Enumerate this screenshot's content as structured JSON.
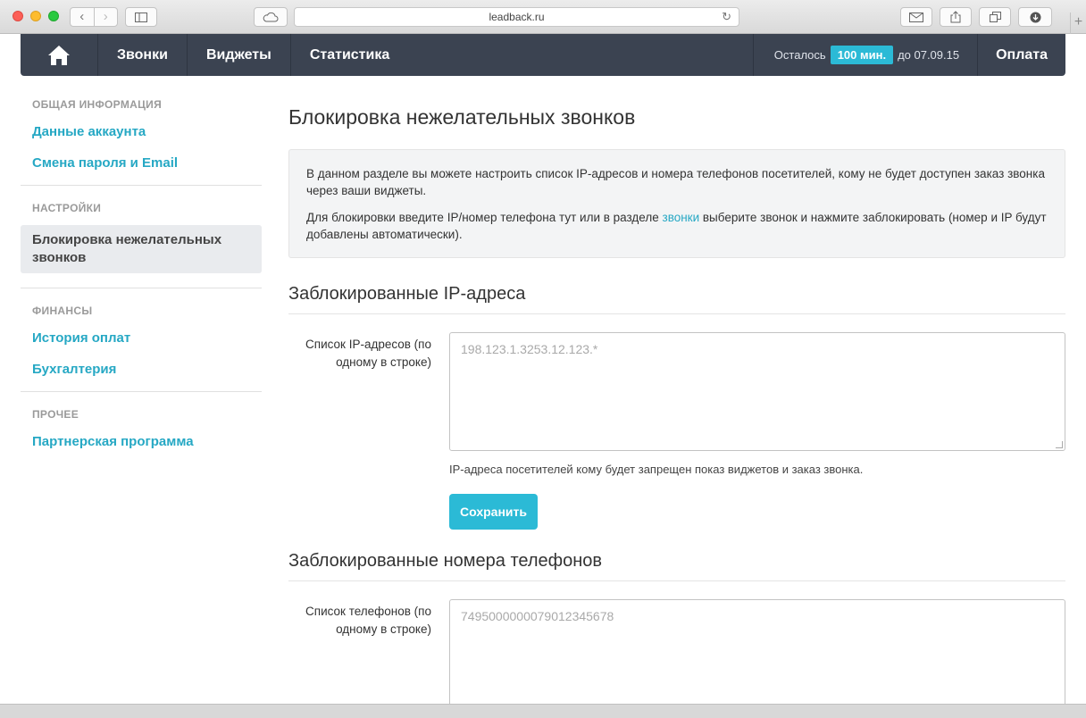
{
  "browser": {
    "url": "leadback.ru",
    "nav_back": "‹",
    "nav_forward": "›",
    "reload": "↻",
    "new_tab": "+"
  },
  "nav": {
    "items": [
      "Звонки",
      "Виджеты",
      "Статистика"
    ],
    "remain_prefix": "Осталось",
    "remain_badge": "100 мин.",
    "remain_suffix": "до 07.09.15",
    "pay": "Оплата"
  },
  "sidebar": {
    "sections": [
      {
        "title": "ОБЩАЯ ИНФОРМАЦИЯ",
        "links": [
          "Данные аккаунта",
          "Смена пароля и Email"
        ]
      },
      {
        "title": "НАСТРОЙКИ",
        "active": "Блокировка нежелательных звонков"
      },
      {
        "title": "ФИНАНСЫ",
        "links": [
          "История оплат",
          "Бухгалтерия"
        ]
      },
      {
        "title": "ПРОЧЕЕ",
        "links": [
          "Партнерская программа"
        ]
      }
    ]
  },
  "main": {
    "title": "Блокировка нежелательных звонков",
    "info_p1": "В данном разделе вы можете настроить список IP-адресов и номера телефонов посетителей, кому не будет доступен заказ звонка через ваши виджеты.",
    "info_p2_before": "Для блокировки введите IP/номер телефона тут или в разделе ",
    "info_p2_link": "звонки",
    "info_p2_after": " выберите звонок и нажмите заблокировать (номер и IP будут добавлены автоматически).",
    "ip_section": {
      "heading": "Заблокированные IP-адреса",
      "label": "Список IP-адресов (по одному в строке)",
      "placeholder": "198.123.1.3253.12.123.*",
      "help": "IP-адреса посетителей кому будет запрещен показ виджетов и заказ звонка.",
      "save": "Сохранить"
    },
    "phone_section": {
      "heading": "Заблокированные номера телефонов",
      "label": "Список телефонов (по одному в строке)",
      "placeholder": "7495000000079012345678"
    }
  }
}
